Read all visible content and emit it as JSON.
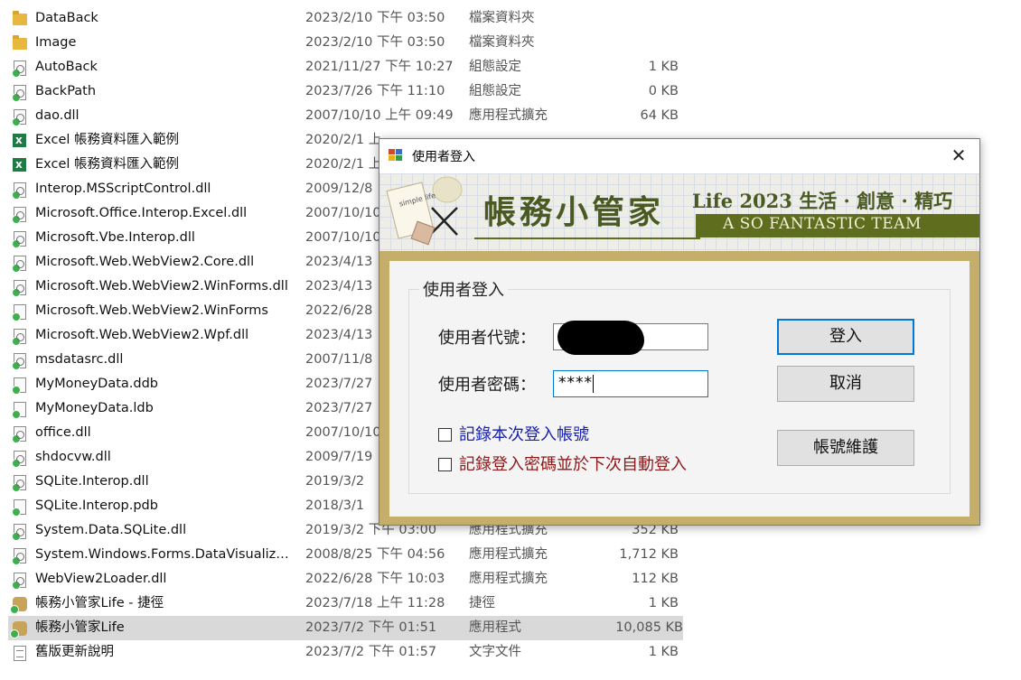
{
  "files": [
    {
      "icon": "folder-icon",
      "name": "DataBack",
      "date": "2023/2/10 下午 03:50",
      "type": "檔案資料夾",
      "size": ""
    },
    {
      "icon": "folder-icon",
      "name": "Image",
      "date": "2023/2/10 下午 03:50",
      "type": "檔案資料夾",
      "size": ""
    },
    {
      "icon": "config-file-icon",
      "name": "AutoBack",
      "date": "2021/11/27 下午 10:27",
      "type": "組態設定",
      "size": "1 KB"
    },
    {
      "icon": "config-file-icon",
      "name": "BackPath",
      "date": "2023/7/26 下午 11:10",
      "type": "組態設定",
      "size": "0 KB"
    },
    {
      "icon": "dll-file-icon",
      "name": "dao.dll",
      "date": "2007/10/10 上午 09:49",
      "type": "應用程式擴充",
      "size": "64 KB"
    },
    {
      "icon": "excel-file-icon",
      "name": "Excel 帳務資料匯入範例",
      "date": "2020/2/1 上",
      "type": "",
      "size": ""
    },
    {
      "icon": "excel-file-icon",
      "name": "Excel 帳務資料匯入範例",
      "date": "2020/2/1 上",
      "type": "",
      "size": ""
    },
    {
      "icon": "dll-file-icon",
      "name": "Interop.MSScriptControl.dll",
      "date": "2009/12/8",
      "type": "",
      "size": ""
    },
    {
      "icon": "dll-file-icon",
      "name": "Microsoft.Office.Interop.Excel.dll",
      "date": "2007/10/10",
      "type": "",
      "size": ""
    },
    {
      "icon": "dll-file-icon",
      "name": "Microsoft.Vbe.Interop.dll",
      "date": "2007/10/10",
      "type": "",
      "size": ""
    },
    {
      "icon": "dll-file-icon",
      "name": "Microsoft.Web.WebView2.Core.dll",
      "date": "2023/4/13",
      "type": "",
      "size": ""
    },
    {
      "icon": "dll-file-icon",
      "name": "Microsoft.Web.WebView2.WinForms.dll",
      "date": "2023/4/13",
      "type": "",
      "size": ""
    },
    {
      "icon": "file-icon",
      "name": "Microsoft.Web.WebView2.WinForms",
      "date": "2022/6/28",
      "type": "",
      "size": ""
    },
    {
      "icon": "dll-file-icon",
      "name": "Microsoft.Web.WebView2.Wpf.dll",
      "date": "2023/4/13",
      "type": "",
      "size": ""
    },
    {
      "icon": "dll-file-icon",
      "name": "msdatasrc.dll",
      "date": "2007/11/8",
      "type": "",
      "size": ""
    },
    {
      "icon": "file-icon",
      "name": "MyMoneyData.ddb",
      "date": "2023/7/27",
      "type": "",
      "size": ""
    },
    {
      "icon": "file-icon",
      "name": "MyMoneyData.ldb",
      "date": "2023/7/27",
      "type": "",
      "size": ""
    },
    {
      "icon": "dll-file-icon",
      "name": "office.dll",
      "date": "2007/10/10",
      "type": "",
      "size": ""
    },
    {
      "icon": "dll-file-icon",
      "name": "shdocvw.dll",
      "date": "2009/7/19",
      "type": "",
      "size": ""
    },
    {
      "icon": "dll-file-icon",
      "name": "SQLite.Interop.dll",
      "date": "2019/3/2",
      "type": "",
      "size": ""
    },
    {
      "icon": "file-icon",
      "name": "SQLite.Interop.pdb",
      "date": "2018/3/1",
      "type": "",
      "size": ""
    },
    {
      "icon": "dll-file-icon",
      "name": "System.Data.SQLite.dll",
      "date": "2019/3/2 下午 03:00",
      "type": "應用程式擴充",
      "size": "352 KB"
    },
    {
      "icon": "dll-file-icon",
      "name": "System.Windows.Forms.DataVisualizati...",
      "date": "2008/8/25 下午 04:56",
      "type": "應用程式擴充",
      "size": "1,712 KB"
    },
    {
      "icon": "dll-file-icon",
      "name": "WebView2Loader.dll",
      "date": "2022/6/28 下午 10:03",
      "type": "應用程式擴充",
      "size": "112 KB"
    },
    {
      "icon": "app-icon",
      "name": "帳務小管家Life - 捷徑",
      "date": "2023/7/18 上午 11:28",
      "type": "捷徑",
      "size": "1 KB"
    },
    {
      "icon": "app-icon",
      "name": "帳務小管家Life",
      "date": "2023/7/2 下午 01:51",
      "type": "應用程式",
      "size": "10,085 KB",
      "selected": true
    },
    {
      "icon": "text-file-icon",
      "name": "舊版更新說明",
      "date": "2023/7/2 下午 01:57",
      "type": "文字文件",
      "size": "1 KB"
    }
  ],
  "dialog": {
    "title": "使用者登入",
    "close_glyph": "✕",
    "banner": {
      "title": "帳務小管家",
      "slogan": "Life 2023 生活 · 創意 · 精巧",
      "team": "A SO FANTASTIC TEAM",
      "notebook_text": "simple life"
    },
    "group_title": "使用者登入",
    "user_id_label": "使用者代號：",
    "password_label": "使用者密碼：",
    "password_value": "****",
    "remember_account_label": "記錄本次登入帳號",
    "auto_login_label": "記錄登入密碼並於下次自動登入",
    "login_button": "登入",
    "cancel_button": "取消",
    "account_maintenance_button": "帳號維護"
  },
  "colors": {
    "banner_green": "#5f6d1f",
    "frame_khaki": "#c4ae6a",
    "focus_blue": "#0078d7",
    "checkbox_blue_text": "#1a22a8",
    "checkbox_red_text": "#8b1a1a"
  }
}
